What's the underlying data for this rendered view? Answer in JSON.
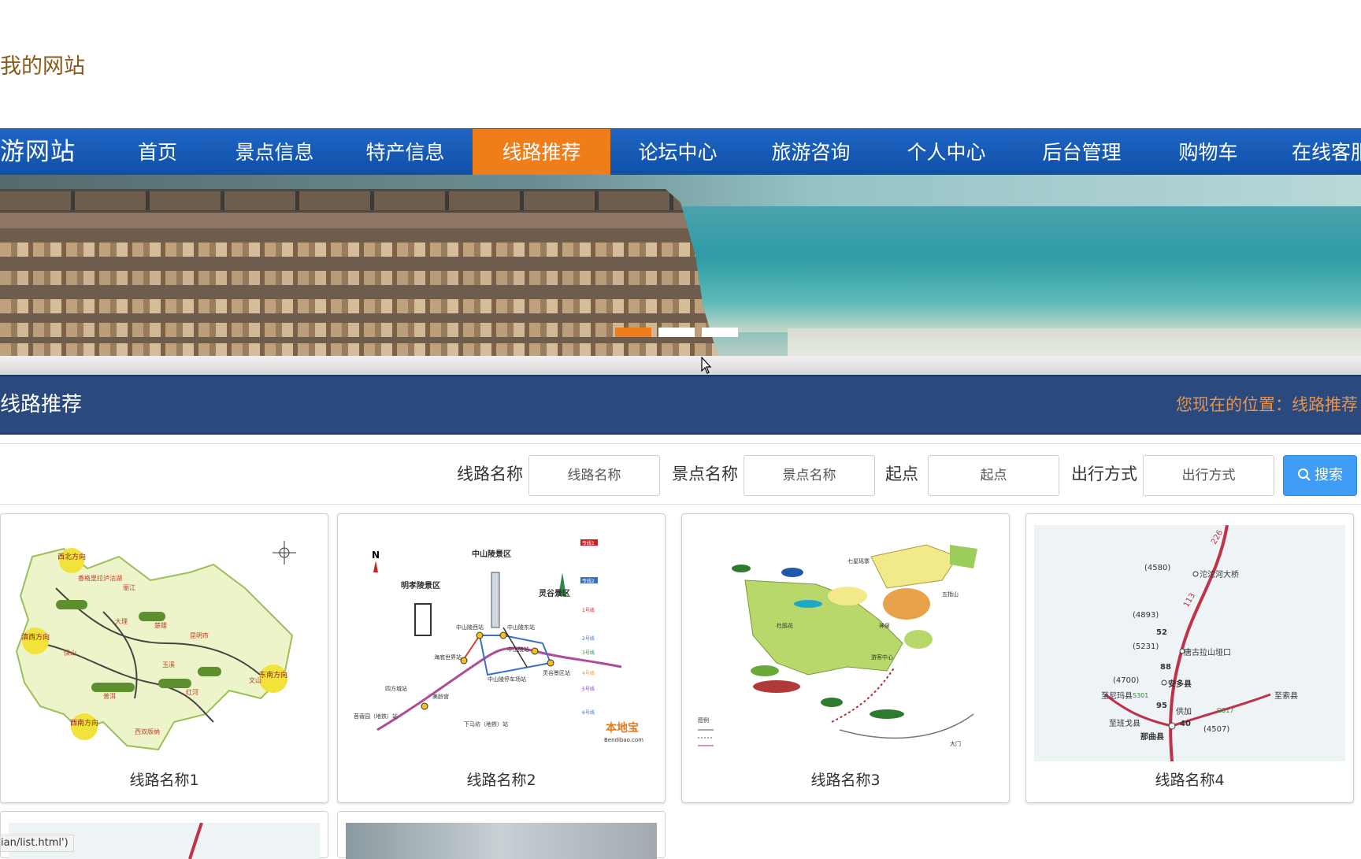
{
  "site": {
    "brand": "我的网站"
  },
  "nav": {
    "brand": "游网站",
    "items": [
      {
        "label": "首页",
        "active": false
      },
      {
        "label": "景点信息",
        "active": false
      },
      {
        "label": "特产信息",
        "active": false
      },
      {
        "label": "线路推荐",
        "active": true
      },
      {
        "label": "论坛中心",
        "active": false
      },
      {
        "label": "旅游咨询",
        "active": false
      },
      {
        "label": "个人中心",
        "active": false
      },
      {
        "label": "后台管理",
        "active": false
      },
      {
        "label": "购物车",
        "active": false
      },
      {
        "label": "在线客服",
        "active": false
      }
    ]
  },
  "carousel": {
    "slides": 3,
    "active_slide": 1
  },
  "section": {
    "title": "线路推荐",
    "breadcrumb_prefix": "您现在的位置：",
    "breadcrumb_current": "线路推荐"
  },
  "search": {
    "route_label": "线路名称",
    "route_placeholder": "线路名称",
    "spot_label": "景点名称",
    "spot_placeholder": "景点名称",
    "start_label": "起点",
    "start_placeholder": "起点",
    "travel_label": "出行方式",
    "travel_placeholder": "出行方式",
    "button_label": "搜索"
  },
  "routes": [
    {
      "caption": "线路名称1",
      "map_labels": [
        "西北方向",
        "东南方向",
        "滇西方向",
        "西南方向",
        "昆明市",
        "大理",
        "楚雄",
        "玉溪",
        "丽江",
        "香格里拉",
        "泸沽湖",
        "保山",
        "普洱",
        "红河",
        "文山",
        "西双版纳"
      ]
    },
    {
      "caption": "线路名称2",
      "map_labels": [
        "N",
        "中山陵景区",
        "明孝陵景区",
        "灵谷景区",
        "中山陵西站",
        "中山陵东站",
        "中山陵站",
        "海底世界站",
        "中山陵停车场站",
        "苜蓿园（地铁）站",
        "四方城站",
        "美龄宫",
        "下马坊（地铁）站",
        "灵谷景区站",
        "专线1",
        "专线2",
        "1号线",
        "2号线",
        "3号线",
        "4号线",
        "5号线",
        "6号线",
        "本地宝",
        "Bendibao.com"
      ]
    },
    {
      "caption": "线路名称3",
      "map_labels": [
        "七星瑶寨",
        "杜鹃花",
        "五指山",
        "神泉",
        "游客中心",
        "大门",
        "图例"
      ]
    },
    {
      "caption": "线路名称4",
      "map_labels": [
        "226",
        "113",
        "(4580)",
        "沱沱河大桥",
        "(4893)",
        "52",
        "(5231)",
        "唐古拉山垭口",
        "88",
        "(4700)",
        "安多县",
        "至尼玛县",
        "S301",
        "95",
        "供加",
        "40",
        "至班戈县",
        "那曲县",
        "至索县",
        "G317",
        "(4507)"
      ]
    }
  ],
  "status_bar": {
    "url": "ian/list.html')"
  },
  "colors": {
    "nav_blue": "#1558b4",
    "accent_orange": "#ef7d1a",
    "section_blue": "#2a4a7e",
    "search_blue": "#3f9df5"
  }
}
